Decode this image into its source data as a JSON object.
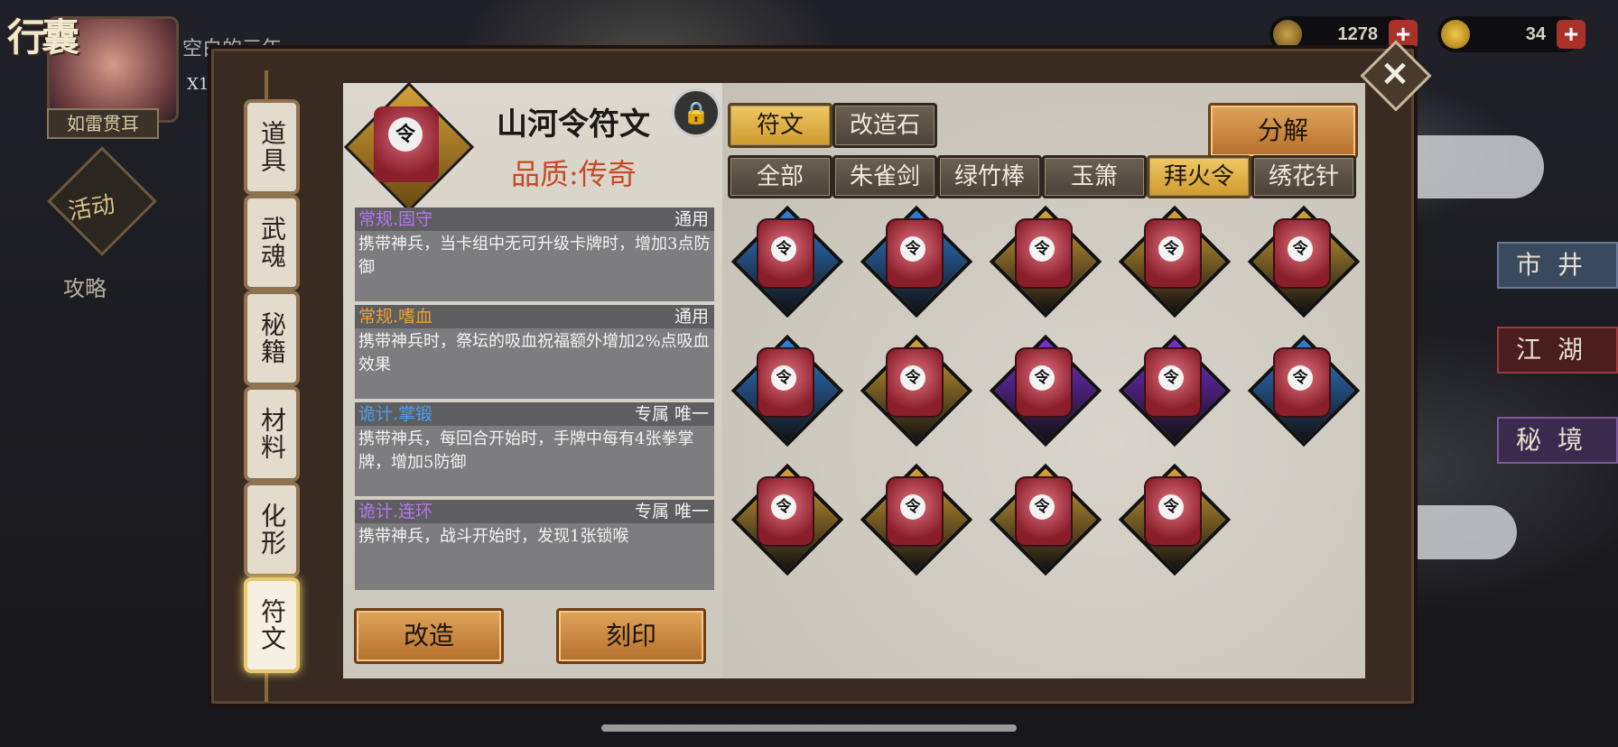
{
  "header": {
    "bag_title": "行囊",
    "player_name": "空白的三年",
    "player_rank": "如雷贯耳",
    "x_count": "X1"
  },
  "side_menu": {
    "event_label": "活动",
    "guide_label": "攻略"
  },
  "currency": [
    {
      "icon": "leaf-coin-icon",
      "value": "1278"
    },
    {
      "icon": "gold-ingot-icon",
      "value": "34"
    }
  ],
  "right_nav": [
    "市井",
    "江湖",
    "秘境"
  ],
  "vertical_tabs": [
    {
      "label": "道具",
      "active": false
    },
    {
      "label": "武魂",
      "active": false
    },
    {
      "label": "秘籍",
      "active": false
    },
    {
      "label": "材料",
      "active": false
    },
    {
      "label": "化形",
      "active": false
    },
    {
      "label": "符文",
      "active": true
    }
  ],
  "item": {
    "name": "山河令符文",
    "quality": "品质:传奇",
    "seal_char": "令",
    "attributes": [
      {
        "name": "常规.固守",
        "name_color": "#b676f0",
        "tag": "通用",
        "desc": "携带神兵，当卡组中无可升级卡牌时，增加3点防御"
      },
      {
        "name": "常规.嗜血",
        "name_color": "#f0a030",
        "tag": "通用",
        "desc": "携带神兵时，祭坛的吸血祝福额外增加2%点吸血效果"
      },
      {
        "name": "诡计.掌锻",
        "name_color": "#4aa0f0",
        "tag": "专属 唯一",
        "desc": "携带神兵，每回合开始时，手牌中每有4张拳掌牌，增加5防御"
      },
      {
        "name": "诡计.连环",
        "name_color": "#b676f0",
        "tag": "专属 唯一",
        "desc": "携带神兵，战斗开始时，发现1张锁喉"
      }
    ]
  },
  "buttons": {
    "modify": "改造",
    "engrave": "刻印",
    "decompose": "分解"
  },
  "top_tabs": [
    {
      "label": "符文",
      "selected": true
    },
    {
      "label": "改造石",
      "selected": false
    }
  ],
  "filter_tabs": [
    {
      "label": "全部",
      "selected": false
    },
    {
      "label": "朱雀剑",
      "selected": false
    },
    {
      "label": "绿竹棒",
      "selected": false
    },
    {
      "label": "玉箫",
      "selected": false
    },
    {
      "label": "拜火令",
      "selected": true
    },
    {
      "label": "绣花针",
      "selected": false
    }
  ],
  "colors": {
    "rarity_blue": "#2f7fd6",
    "rarity_gold": "#d6a334",
    "rarity_purple": "#7b2ed6"
  },
  "runes": [
    {
      "frame": "rarity_blue"
    },
    {
      "frame": "rarity_blue"
    },
    {
      "frame": "rarity_gold"
    },
    {
      "frame": "rarity_gold"
    },
    {
      "frame": "rarity_gold"
    },
    {
      "frame": "rarity_blue"
    },
    {
      "frame": "rarity_gold"
    },
    {
      "frame": "rarity_purple"
    },
    {
      "frame": "rarity_purple"
    },
    {
      "frame": "rarity_blue"
    },
    {
      "frame": "rarity_gold"
    },
    {
      "frame": "rarity_gold"
    },
    {
      "frame": "rarity_gold"
    },
    {
      "frame": "rarity_gold"
    }
  ]
}
